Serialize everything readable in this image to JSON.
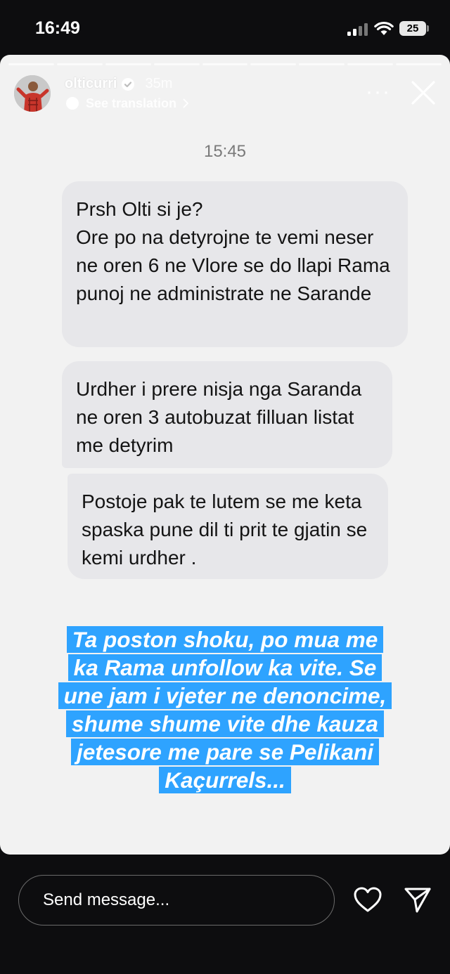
{
  "status": {
    "time": "16:49",
    "battery": "25"
  },
  "story": {
    "username": "olticurri",
    "time_ago": "35m",
    "translate_label": "See translation",
    "more": "···"
  },
  "chat": {
    "time": "15:45",
    "messages": [
      "Prsh Olti si je?\nOre po na detyrojne te vemi neser ne oren 6 ne Vlore se do llapi Rama  punoj ne administrate ne Sarande",
      "Urdher i prere nisja nga Saranda ne oren 3 autobuzat filluan listat me detyrim",
      "Postoje pak te lutem se me keta spaska pune dil ti prit te gjatin se kemi urdher ."
    ]
  },
  "caption_lines": [
    "Ta poston shoku, po mua me",
    "ka Rama unfollow ka vite. Se",
    "une jam i vjeter ne denoncime,",
    "shume shume vite dhe kauza",
    "jetesore me pare se Pelikani",
    "Kaçurrels..."
  ],
  "reply": {
    "placeholder": "Send message..."
  },
  "colors": {
    "caption_bg": "#2ea3ff",
    "bubble_bg": "#e7e7ea",
    "story_bg": "#f2f2f2"
  },
  "icons": [
    "verified-icon",
    "chevron-right-icon",
    "close-icon",
    "heart-icon",
    "send-icon"
  ]
}
